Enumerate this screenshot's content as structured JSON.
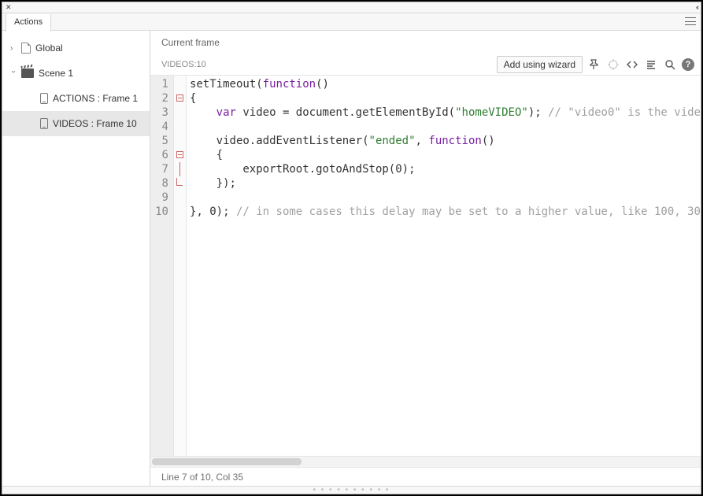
{
  "panel": {
    "title": "Actions"
  },
  "tree": {
    "global_label": "Global",
    "scene_label": "Scene 1",
    "frame_actions_label": "ACTIONS : Frame 1",
    "frame_videos_label": "VIDEOS : Frame 10"
  },
  "editor": {
    "breadcrumb": "Current frame",
    "frame_label": "VIDEOS:10",
    "wizard_button": "Add using wizard",
    "status": "Line 7 of 10, Col 35",
    "line_numbers": [
      "1",
      "2",
      "3",
      "4",
      "5",
      "6",
      "7",
      "8",
      "9",
      "10"
    ],
    "code": {
      "l1_a": "setTimeout(",
      "l1_kw": "function",
      "l1_b": "()",
      "l2": "{",
      "l3_a": "    ",
      "l3_kw": "var",
      "l3_b": " video = document.getElementById(",
      "l3_str": "\"homeVIDEO\"",
      "l3_c": "); ",
      "l3_com": "// \"video0\" is the vide",
      "l4": "",
      "l5_a": "    video.addEventListener(",
      "l5_str": "\"ended\"",
      "l5_b": ", ",
      "l5_kw": "function",
      "l5_c": "()",
      "l6": "    {",
      "l7": "        exportRoot.gotoAndStop(0);",
      "l8": "    });",
      "l9": "",
      "l10_a": "}, 0); ",
      "l10_com": "// in some cases this delay may be set to a higher value, like 100, 30"
    }
  }
}
